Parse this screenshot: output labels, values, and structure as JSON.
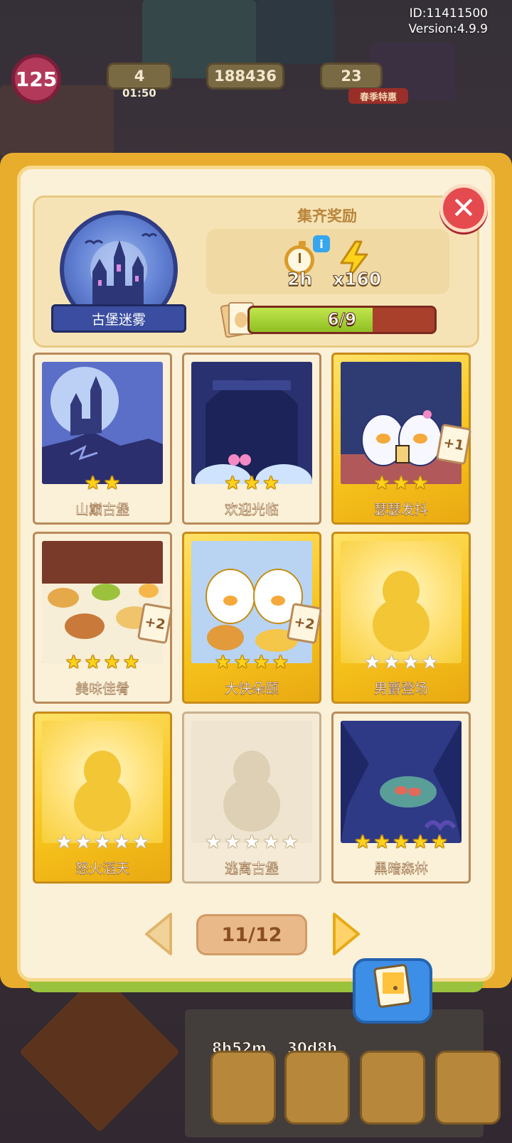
{
  "meta": {
    "id_text": "ID:11411500",
    "version_text": "Version:4.9.9"
  },
  "hud": {
    "level": "125",
    "energy_count": "4",
    "energy_timer": "01:50",
    "coins": "188436",
    "gems": "23",
    "event_label": "春季特惠"
  },
  "collection": {
    "name": "古堡迷雾",
    "reward_title": "集齐奖励",
    "reward_time": "2h",
    "reward_energy": "x160",
    "progress_text": "6/9",
    "progress_fraction": 0.667
  },
  "cards": [
    {
      "name": "山巅古堡",
      "stars": 2,
      "max_stars": 2,
      "state": "owned",
      "frame": "plain",
      "duplicate": ""
    },
    {
      "name": "欢迎光临",
      "stars": 3,
      "max_stars": 3,
      "state": "owned",
      "frame": "plain",
      "duplicate": ""
    },
    {
      "name": "瑟瑟发抖",
      "stars": 3,
      "max_stars": 3,
      "state": "owned",
      "frame": "gold",
      "duplicate": "+1"
    },
    {
      "name": "美味佳肴",
      "stars": 4,
      "max_stars": 4,
      "state": "owned",
      "frame": "plain",
      "duplicate": "+2"
    },
    {
      "name": "大快朵颐",
      "stars": 4,
      "max_stars": 4,
      "state": "owned",
      "frame": "gold",
      "duplicate": "+2"
    },
    {
      "name": "男爵登场",
      "stars": 0,
      "max_stars": 4,
      "state": "locked",
      "frame": "gold",
      "duplicate": ""
    },
    {
      "name": "怒火滔天",
      "stars": 0,
      "max_stars": 5,
      "state": "locked",
      "frame": "gold",
      "duplicate": ""
    },
    {
      "name": "逃离古堡",
      "stars": 0,
      "max_stars": 5,
      "state": "locked",
      "frame": "plain",
      "duplicate": ""
    },
    {
      "name": "黑暗森林",
      "stars": 5,
      "max_stars": 5,
      "state": "owned",
      "frame": "plain",
      "duplicate": ""
    }
  ],
  "pager": {
    "text": "11/12"
  },
  "bottom_bar": {
    "timer_1": "8h52m",
    "timer_2": "30d8h"
  },
  "colors": {
    "panel": "#fbf1d8",
    "gold_frame": "#f6c21b",
    "progress_fill": "#8fbf22",
    "progress_track": "#a8402c",
    "close": "#e54a4f"
  }
}
